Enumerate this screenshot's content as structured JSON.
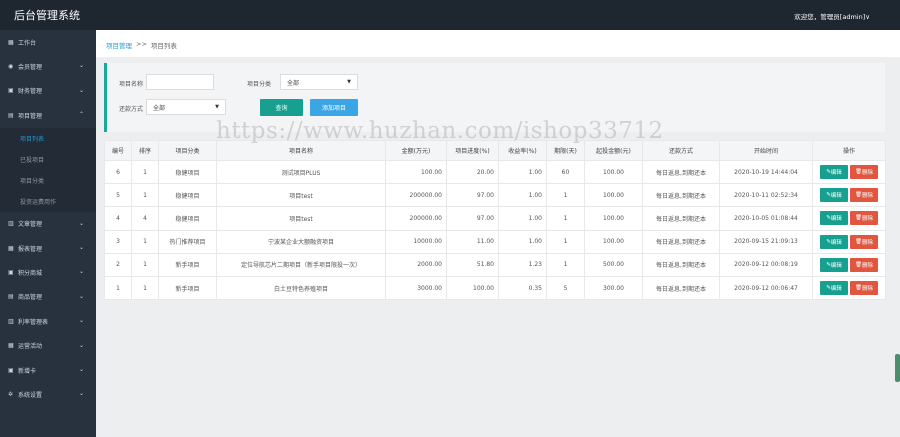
{
  "header": {
    "app_title": "后台管理系统",
    "user_menu": "欢迎您，管理员[admin]∨"
  },
  "sidebar": {
    "items": [
      {
        "icon": "dashboard-icon",
        "label": "工作台",
        "has_children": false
      },
      {
        "icon": "user-icon",
        "label": "会员管理",
        "has_children": true
      },
      {
        "icon": "finance-icon",
        "label": "财务管理",
        "has_children": true
      },
      {
        "icon": "project-icon",
        "label": "项目管理",
        "has_children": true,
        "expanded": true,
        "children": [
          {
            "label": "项目列表",
            "active": true
          },
          {
            "label": "已投项目",
            "active": false
          },
          {
            "label": "项目分类",
            "active": false
          },
          {
            "label": "投资运费用作",
            "active": false
          }
        ]
      },
      {
        "icon": "article-icon",
        "label": "文章管理",
        "has_children": true
      },
      {
        "icon": "report-icon",
        "label": "报表管理",
        "has_children": true
      },
      {
        "icon": "mall-icon",
        "label": "积分商城",
        "has_children": true
      },
      {
        "icon": "product-icon",
        "label": "商品管理",
        "has_children": true
      },
      {
        "icon": "rate-icon",
        "label": "利率管理表",
        "has_children": true
      },
      {
        "icon": "activity-icon",
        "label": "运营活动",
        "has_children": true
      },
      {
        "icon": "card-icon",
        "label": "新增卡",
        "has_children": true
      },
      {
        "icon": "settings-icon",
        "label": "系统设置",
        "has_children": true
      }
    ]
  },
  "breadcrumb": {
    "parent": "项目管理",
    "separator": ">>",
    "current": "项目列表"
  },
  "filters": {
    "name_label": "项目名称",
    "name_value": "",
    "name_placeholder": "",
    "category_label": "项目分类",
    "category_value": "全部",
    "return_label": "还款方式",
    "return_value": "全部",
    "search_button": "查询",
    "add_button": "添加项目"
  },
  "table": {
    "headers": [
      "编号",
      "排序",
      "项目分类",
      "项目名称",
      "金额(万元)",
      "项目进度(%)",
      "收益率(%)",
      "期限(天)",
      "起投金额(元)",
      "还款方式",
      "开始时间",
      "操作"
    ],
    "edit_label": "编辑",
    "delete_label": "删除",
    "rows": [
      [
        "6",
        "1",
        "稳健项目",
        "测试项目PLUS",
        "100.00",
        "20.00",
        "1.00",
        "60",
        "100.00",
        "每日返息,到期还本",
        "2020-10-19 14:44:04"
      ],
      [
        "5",
        "1",
        "稳健项目",
        "项目test",
        "200000.00",
        "97.00",
        "1.00",
        "1",
        "100.00",
        "每日返息,到期还本",
        "2020-10-11 02:52:34"
      ],
      [
        "4",
        "4",
        "稳健项目",
        "项目test",
        "200000.00",
        "97.00",
        "1.00",
        "1",
        "100.00",
        "每日返息,到期还本",
        "2020-10-05 01:08:44"
      ],
      [
        "3",
        "1",
        "热门推荐项目",
        "宁波某企业大额融资项目",
        "10000.00",
        "11.00",
        "1.00",
        "1",
        "100.00",
        "每日返息,到期还本",
        "2020-09-15 21:09:13"
      ],
      [
        "2",
        "1",
        "新手项目",
        "定位导航芯片二期项目（新手项目限投一次）",
        "2000.00",
        "51.80",
        "1.23",
        "1",
        "500.00",
        "每日返息,到期还本",
        "2020-09-12 00:08:19"
      ],
      [
        "1",
        "1",
        "新手项目",
        "白土豆特色养殖项目",
        "3000.00",
        "100.00",
        "0.35",
        "5",
        "300.00",
        "每日返息,到期还本",
        "2020-09-12 00:06:47"
      ]
    ]
  },
  "watermark": "https://www.huzhan.com/ishop33712"
}
